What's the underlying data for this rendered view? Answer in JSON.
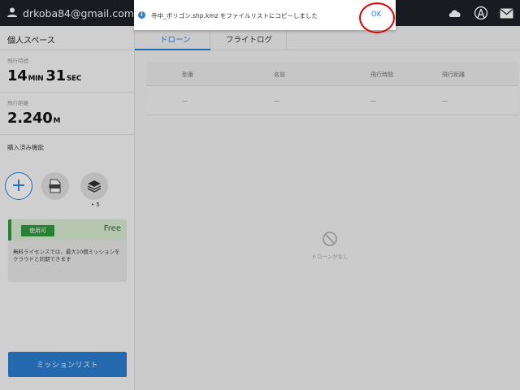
{
  "header": {
    "email": "drkoba84@gmail.com",
    "icons": [
      "user-icon",
      "cloud-icon",
      "antenna-icon",
      "mail-icon"
    ]
  },
  "sidebar": {
    "title": "個人スペース",
    "flight_time": {
      "label": "飛行時間",
      "minutes": "14",
      "min_unit": "MIN",
      "seconds": "31",
      "sec_unit": "SEC"
    },
    "flight_distance": {
      "label": "飛行距離",
      "value": "2.240",
      "unit": "M"
    },
    "purchased_label": "購入済み機能",
    "layer_count": "• 5",
    "kml_label": "KML",
    "license": {
      "status": "使用可",
      "plan": "Free",
      "description": "無料ライセンスでは、最大10個ミッションをクラウドと同期できます"
    },
    "mission_list_button": "ミッションリスト"
  },
  "tabs": [
    {
      "label": "ドローン",
      "active": true
    },
    {
      "label": "フライトログ",
      "active": false
    }
  ],
  "table": {
    "headers": [
      "型番",
      "名前",
      "飛行時間",
      "飛行距離"
    ],
    "row": [
      "—",
      "—",
      "—",
      "—"
    ]
  },
  "empty_state": {
    "text": "ドローンがなし"
  },
  "toast": {
    "message": "寺中_ポリゴン.shp.kmz をファイルリストにコピーしました",
    "ok_label": "OK"
  },
  "colors": {
    "accent": "#2d7fd0",
    "topbar": "#1d2228",
    "license_green": "#2f9a3e",
    "annotation_red": "#e00000"
  }
}
